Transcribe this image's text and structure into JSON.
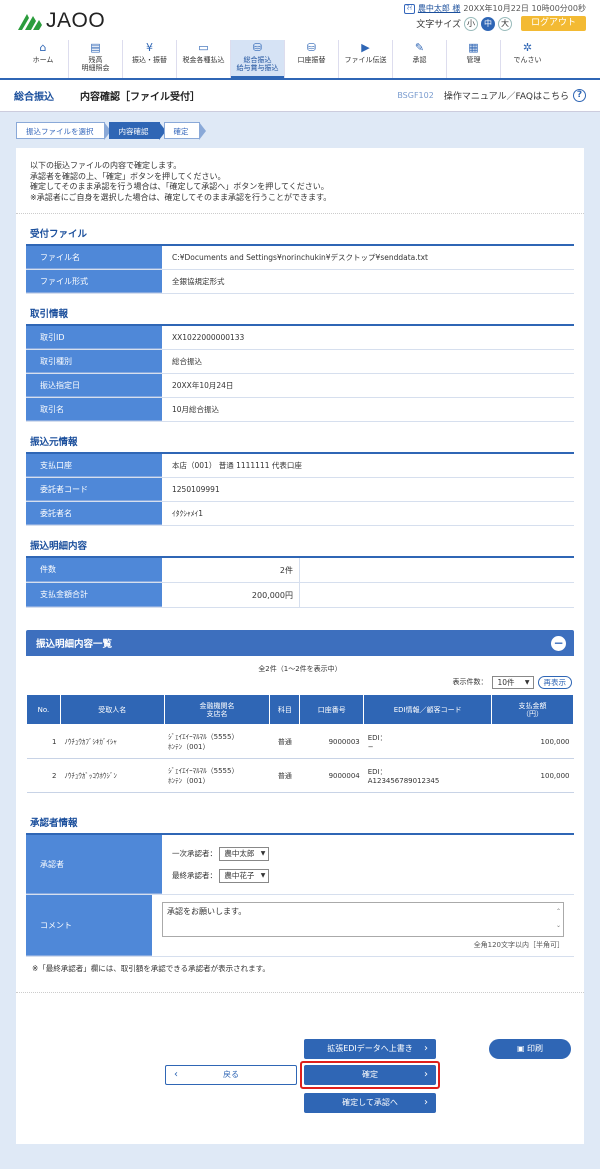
{
  "header": {
    "logo_text": "JA",
    "logo_suffix": "OO",
    "user_name": "農中太郎 様",
    "user_icon": "ﾏｲ",
    "login_time": "20XX年10月22日 10時00分00秒",
    "font_size_label": "文字サイズ",
    "font_sizes": [
      "小",
      "中",
      "大"
    ],
    "logout_label": "ログアウト"
  },
  "nav": [
    {
      "icon": "home-icon",
      "glyph": "⌂",
      "label": "ホーム"
    },
    {
      "icon": "balance-icon",
      "glyph": "▤",
      "label": "残高\n明細照会"
    },
    {
      "icon": "transfer-icon",
      "glyph": "¥",
      "label": "振込・振替"
    },
    {
      "icon": "tax-icon",
      "glyph": "▭",
      "label": "税金各種払込"
    },
    {
      "icon": "bulk-transfer-icon",
      "glyph": "⛁",
      "label": "総合振込\n給与賞与振込"
    },
    {
      "icon": "direct-debit-icon",
      "glyph": "⛁",
      "label": "口座振替"
    },
    {
      "icon": "file-icon",
      "glyph": "▶",
      "label": "ファイル伝送"
    },
    {
      "icon": "approval-icon",
      "glyph": "✎",
      "label": "承認"
    },
    {
      "icon": "admin-icon",
      "glyph": "▦",
      "label": "管理"
    },
    {
      "icon": "densai-icon",
      "glyph": "✲",
      "label": "でんさい"
    }
  ],
  "title_bar": {
    "category": "総合振込",
    "title": "内容確認［ファイル受付］",
    "code": "BSGF102",
    "help": "操作マニュアル／FAQはこちら",
    "help_icon": "?"
  },
  "crumbs": [
    "振込ファイルを選択",
    "内容確認",
    "確定"
  ],
  "intro": [
    "以下の振込ファイルの内容で確定します。",
    "承認者を確認の上、「確定」ボタンを押してください。",
    "確定してそのまま承認を行う場合は、「確定して承認へ」ボタンを押してください。",
    "※承認者にご自身を選択した場合は、確定してそのまま承認を行うことができます。"
  ],
  "file_section": {
    "title": "受付ファイル",
    "rows": [
      {
        "k": "ファイル名",
        "v": "C:¥Documents and Settings¥norinchukin¥デスクトップ¥senddata.txt"
      },
      {
        "k": "ファイル形式",
        "v": "全銀協規定形式"
      }
    ]
  },
  "trans_section": {
    "title": "取引情報",
    "rows": [
      {
        "k": "取引ID",
        "v": "XX1022000000133"
      },
      {
        "k": "取引種別",
        "v": "総合振込"
      },
      {
        "k": "振込指定日",
        "v": "20XX年10月24日"
      },
      {
        "k": "取引名",
        "v": "10月総合振込"
      }
    ]
  },
  "source_section": {
    "title": "振込元情報",
    "rows": [
      {
        "k": "支払口座",
        "v": "本店（001） 普通 1111111 代表口座"
      },
      {
        "k": "委託者コード",
        "v": "1250109991"
      },
      {
        "k": "委託者名",
        "v": "ｲﾀｸｼｬﾒｲ1"
      }
    ]
  },
  "detail_section": {
    "title": "振込明細内容",
    "rows": [
      {
        "k": "件数",
        "v": "2件"
      },
      {
        "k": "支払金額合計",
        "v": "200,000円"
      }
    ]
  },
  "list": {
    "title": "振込明細内容一覧",
    "collapse_icon": "−",
    "count_text": "全2件（1〜2件を表示中）",
    "per_page_label": "表示件数：",
    "per_page_value": "10件",
    "redisplay": "再表示",
    "headers": [
      "No.",
      "受取人名",
      "金融機関名\n支店名",
      "科目",
      "口座番号",
      "EDI情報／顧客コード",
      "支払金額\n（円）"
    ],
    "rows": [
      {
        "no": "1",
        "name": "ﾉｳﾁｭｳｶﾌﾞｼｷｶﾞｲｼｬ",
        "bank": "ｼﾞｪｲｴｲｰﾏﾙﾏﾙ（5555）",
        "branch": "ﾎﾝﾃﾝ（001）",
        "type": "普通",
        "acct": "9000003",
        "edi": "EDI：",
        "edi2": "−",
        "amount": "100,000"
      },
      {
        "no": "2",
        "name": "ﾉｳﾁｭｳｶﾞｯｺｳﾎｳｼﾞﾝ",
        "bank": "ｼﾞｪｲｴｲｰﾏﾙﾏﾙ（5555）",
        "branch": "ﾎﾝﾃﾝ（001）",
        "type": "普通",
        "acct": "9000004",
        "edi": "EDI：",
        "edi2": "A123456789012345",
        "amount": "100,000"
      }
    ]
  },
  "approver_section": {
    "title": "承認者情報",
    "approver_label": "承認者",
    "first_label": "一次承認者：",
    "first_value": "農中太郎",
    "final_label": "最終承認者：",
    "final_value": "農中花子",
    "comment_label": "コメント",
    "comment_value": "承認をお願いします。",
    "limit": "全角120文字以内［半角可］",
    "note": "※「最終承認者」欄には、取引額を承認できる承認者が表示されます。"
  },
  "buttons": {
    "edi": "拡張EDIデータへ上書き",
    "print": "印刷",
    "back": "戻る",
    "confirm": "確定",
    "confirm_approve": "確定して承認へ"
  },
  "colors": {
    "primary": "#2f66b5",
    "accent": "#f3ba33",
    "highlight": "#e0201c"
  }
}
